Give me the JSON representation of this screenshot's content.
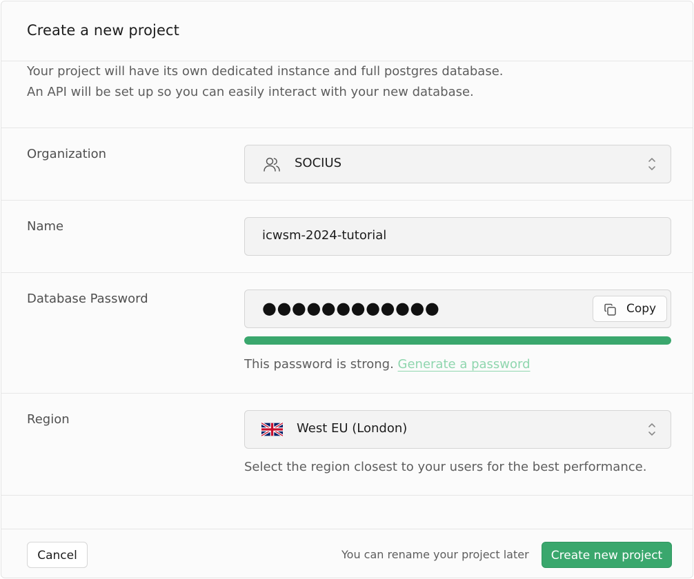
{
  "dialog": {
    "title": "Create a new project",
    "intro_line1": "Your project will have its own dedicated instance and full postgres database.",
    "intro_line2": "An API will be set up so you can easily interact with your new database."
  },
  "organization": {
    "label": "Organization",
    "selected": "SOCIUS",
    "icon": "users-icon"
  },
  "name": {
    "label": "Name",
    "value": "icwsm-2024-tutorial"
  },
  "password": {
    "label": "Database Password",
    "masked_value": "●●●●●●●●●●●●",
    "copy_label": "Copy",
    "strength_fraction": 1.0,
    "strength_color": "#3aa76d",
    "strength_text": "This password is strong.",
    "generate_link": "Generate a password"
  },
  "region": {
    "label": "Region",
    "selected": "West EU (London)",
    "flag_icon": "uk-flag-icon",
    "help": "Select the region closest to your users for the best performance."
  },
  "footer": {
    "cancel_label": "Cancel",
    "note": "You can rename your project later",
    "create_label": "Create new project"
  },
  "colors": {
    "accent": "#3aa76d",
    "link": "#8fd6ae"
  }
}
